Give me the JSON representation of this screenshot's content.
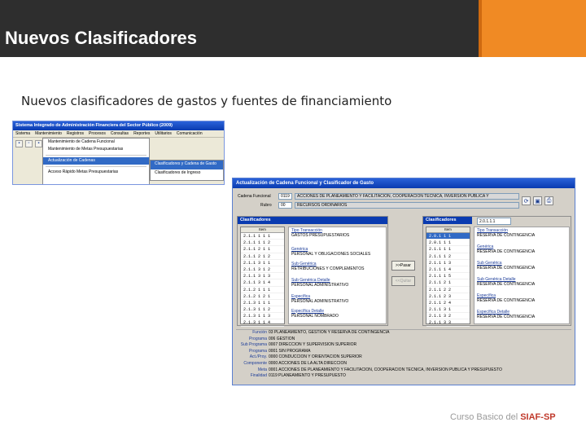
{
  "slide": {
    "title": "Nuevos Clasificadores",
    "subtitle": "Nuevos clasificadores de gastos y fuentes de financiamiento",
    "footer_text": "Curso Basico del",
    "footer_brand": "SIAF-SP",
    "colors": {
      "header": "#2e2e2e",
      "accent": "#f08a24",
      "brand": "#c0392b"
    }
  },
  "app_window": {
    "title": "Sistema Integrado de Administración Financiera del Sector Público (2009)",
    "menus": [
      "Sistema",
      "Mantenimiento",
      "Registros",
      "Procesos",
      "Consultas",
      "Reportes",
      "Utilitarios",
      "Comunicación"
    ],
    "dropdown_items": [
      "Mantenimiento de Cadena Funcional",
      "Mantenimiento de Metas Presupuestarias",
      "Actualización de Cadenas",
      "Acceso Rápido Metas Presupuestarias"
    ],
    "dropdown_selected": 2,
    "submenu_items": [
      "Clasificadores y Cadena de Gasto",
      "Clasificadores de Ingreso"
    ],
    "submenu_selected": 0
  },
  "dialog": {
    "title": "Actualización de Cadena Funcional y Clasificador de Gasto",
    "top": {
      "cadena_label": "Cadena Funcional",
      "cadena_code": "0119",
      "cadena_value": "ACCIONES DE PLANEAMIENTO Y FACILITACION, COOPERACION TECNICA, INVERSION PUBLICA Y",
      "rubro_label": "Rubro",
      "rubro_code": "00",
      "rubro_value": "RECURSOS ORDINARIOS"
    },
    "left_panel": {
      "header": "Clasificadores",
      "column_header": "Item",
      "rows": [
        "2.1.1 1 1 1",
        "2.1.1 1 1 2",
        "2.1.1 2 1 1",
        "2.1.1 2 1 2",
        "2.1.1 3 1 1",
        "2.1.1 3 1 2",
        "2.1.1 3 1 3",
        "2.1.1 3 1 4",
        "2.1.2 1 1 1",
        "2.1.2 1 2 1",
        "2.1.3 1 1 1",
        "2.1.3 1 1 2",
        "2.1.3 1 1 3",
        "2.1.3 1 1 4",
        "2.1.3 1 1 5"
      ],
      "details": [
        {
          "label": "Tipo Transacción",
          "value": "GASTOS PRESUPUESTARIOS"
        },
        {
          "label": "Genérica",
          "value": "PERSONAL Y OBLIGACIONES SOCIALES"
        },
        {
          "label": "Sub Genérica",
          "value": "RETRIBUCIONES Y COMPLEMENTOS"
        },
        {
          "label": "Sub Genérica Detalle",
          "value": "PERSONAL ADMINISTRATIVO"
        },
        {
          "label": "Específica",
          "value": "PERSONAL ADMINISTRATIVO"
        },
        {
          "label": "Específica Detalle",
          "value": "PERSONAL NOMBRADO"
        }
      ]
    },
    "buttons": {
      "add": ">>Pasar",
      "remove": "<<Quitar"
    },
    "right_panel": {
      "header": "Clasificadores",
      "filter": "2.0.1.1.1",
      "column_header": "Item",
      "rows": [
        "2.0.1 1 1",
        "2.0.1 1 1",
        "2.1.1 1 1",
        "2.1.1 1 2",
        "2.1.1 1 3",
        "2.1.1 1 4",
        "2.1.1 1 5",
        "2.1.1 2 1",
        "2.1.1 2 2",
        "2.1.1 2 3",
        "2.1.1 2 4",
        "2.1.1 3 1",
        "2.1.1 3 2",
        "2.1.1 3 3",
        "2.1.2 1 2"
      ],
      "selected": 0,
      "details": [
        {
          "label": "Tipo Transacción",
          "value": "RESERVA DE CONTINGENCIA"
        },
        {
          "label": "Genérica",
          "value": "RESERVA DE CONTINGENCIA"
        },
        {
          "label": "Sub Genérica",
          "value": "RESERVA DE CONTINGENCIA"
        },
        {
          "label": "Sub Genérica Detalle",
          "value": "RESERVA DE CONTINGENCIA"
        },
        {
          "label": "Específica",
          "value": "RESERVA DE CONTINGENCIA"
        },
        {
          "label": "Específica Detalle",
          "value": "RESERVA DE CONTINGENCIA"
        }
      ]
    },
    "bottom_rows": [
      {
        "label": "Función",
        "value": "03 PLANEAMIENTO, GESTION Y RESERVA DE CONTINGENCIA"
      },
      {
        "label": "Programa",
        "value": "006 GESTION"
      },
      {
        "label": "Sub Programa",
        "value": "0007 DIRECCION Y SUPERVISION SUPERIOR"
      },
      {
        "label": "Programa",
        "value": "0001 SIN PROGRAMA"
      },
      {
        "label": "Act./Proy.",
        "value": "0000 CONDUCCION Y ORIENTACION SUPERIOR"
      },
      {
        "label": "Componente",
        "value": "0000 ACCIONES DE LA ALTA DIRECCION"
      },
      {
        "label": "Meta",
        "value": "0001 ACCIONES DE PLANEAMIENTO Y FACILITACION, COOPERACION TECNICA, INVERSION PUBLICA Y PRESUPUESTO"
      },
      {
        "label": "Finalidad",
        "value": "0119 PLANEAMIENTO Y PRESUPUESTO"
      }
    ]
  }
}
